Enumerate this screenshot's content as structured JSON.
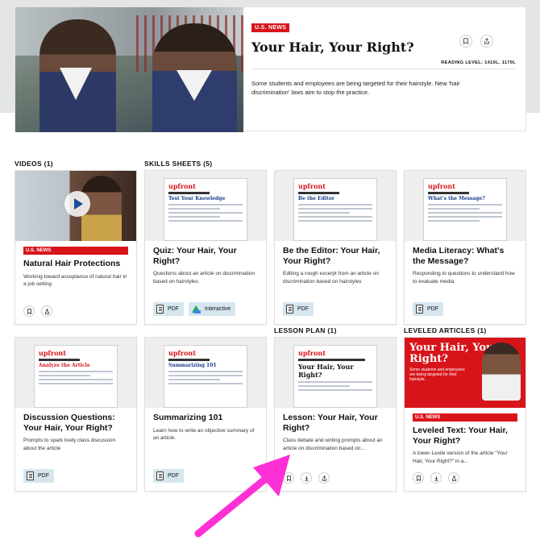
{
  "hero": {
    "tag": "U.S. NEWS",
    "title": "Your Hair, Your Right?",
    "reading_level": "READING LEVEL: 1410L, 1170L",
    "description": "Some students and employees are being targeted for their hairstyle. New 'hair discrimination' laws aim to stop the practice."
  },
  "sections": {
    "videos": "VIDEOS (1)",
    "skills": "SKILLS SHEETS (5)",
    "lesson": "LESSON PLAN (1)",
    "leveled": "LEVELED ARTICLES (1)"
  },
  "cards": {
    "video": {
      "tag": "U.S. NEWS",
      "title": "Natural Hair Protections",
      "desc": "Working toward acceptance of natural hair in a job setting"
    },
    "quiz": {
      "sheet_title": "Test Your Knowledge",
      "title": "Quiz: Your Hair, Your Right?",
      "desc": "Questions about an article on discrimination based on hairstyles",
      "pdf": "PDF",
      "interactive": "Interactive"
    },
    "editor": {
      "sheet_title": "Be the Editor",
      "title": "Be the Editor: Your Hair, Your Right?",
      "desc": "Editing a rough excerpt from an article on discrimination based on hairstyles",
      "pdf": "PDF"
    },
    "media": {
      "sheet_title": "What's the Message?",
      "title": "Media Literacy: What's the Message?",
      "desc": "Responding to questions to understand how to evaluate media",
      "pdf": "PDF"
    },
    "discussion": {
      "sheet_title": "Analyze the Article",
      "title": "Discussion Questions: Your Hair, Your Right?",
      "desc": "Prompts to spark lively class discussion about the article",
      "pdf": "PDF"
    },
    "summarizing": {
      "sheet_title": "Summarizing 101",
      "title": "Summarizing 101",
      "desc": "Learn how to write an objective summary of an article.",
      "pdf": "PDF"
    },
    "lesson": {
      "sheet_title": "Your Hair, Your Right?",
      "title": "Lesson: Your Hair, Your Right?",
      "desc": "Class debate and writing prompts about an article on discrimination based on..."
    },
    "leveled": {
      "mag_title": "Your Hair, Your Right?",
      "mag_sub": "Some students and employees are being targeted for their hairstyle.",
      "tag": "U.S. NEWS",
      "title": "Leveled Text: Your Hair, Your Right?",
      "desc": "A lower-Lexile version of the article \"Your Hair, Your Right?\" in a..."
    }
  },
  "brand": {
    "logo": "upfront"
  },
  "colors": {
    "accent": "#d7141a",
    "badge": "#d6e6ef",
    "arrow": "#ff2fd6"
  }
}
